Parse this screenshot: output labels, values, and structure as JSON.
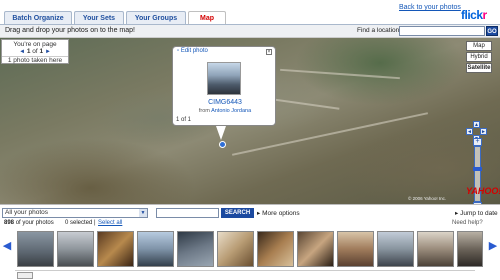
{
  "tabs": [
    {
      "label": "Batch Organize",
      "active": false
    },
    {
      "label": "Your Sets",
      "active": false
    },
    {
      "label": "Your Groups",
      "active": false
    },
    {
      "label": "Map",
      "active": true
    }
  ],
  "header": {
    "back_link": "Back to your photos",
    "logo_part1": "flick",
    "logo_part2": "r"
  },
  "toolbar": {
    "instruction": "Drag and drop your photos on to the map!",
    "find_label": "Find a location",
    "find_value": "",
    "go_label": "GO"
  },
  "map": {
    "page_line1": "You're on page",
    "page_current": "1",
    "page_of": "of",
    "page_total": "1",
    "photos_taken": "1 photo taken here",
    "type_buttons": [
      "Map",
      "Hybrid",
      "Satellite"
    ],
    "popup": {
      "header": "Edit photo",
      "photo_title": "CIMG6443",
      "from_label": "from",
      "from_user": "Antonio Jordana",
      "count": "1 of 1"
    },
    "provider": "YAHOO!",
    "copyright": "© 2006 Yahoo! Inc."
  },
  "filter": {
    "select_value": "All your photos",
    "search_value": "",
    "search_label": "SEARCH",
    "more_options": "More options",
    "jump_to_date": "Jump to date"
  },
  "info": {
    "photo_count": "898",
    "photo_count_suffix": "of your photos",
    "selected": "0 selected |",
    "select_all": "Select all",
    "help": "Need help?"
  },
  "colors": {
    "accent_blue": "#1c4aa0",
    "active_tab_red": "#d40000",
    "flickr_blue": "#0063dc",
    "flickr_pink": "#ff0084"
  }
}
